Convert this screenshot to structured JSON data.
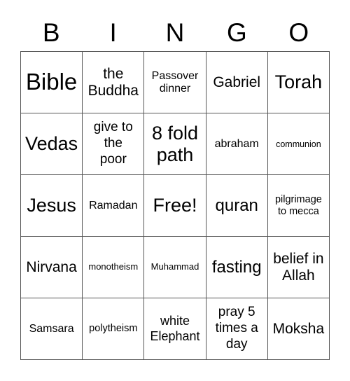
{
  "header": {
    "letters": [
      "B",
      "I",
      "N",
      "G",
      "O"
    ]
  },
  "card": {
    "rows": [
      [
        "Bible",
        "the Buddha",
        "Passover dinner",
        "Gabriel",
        "Torah"
      ],
      [
        "Vedas",
        "give to the poor",
        "8 fold path",
        "abraham",
        "communion"
      ],
      [
        "Jesus",
        "Ramadan",
        "Free!",
        "quran",
        "pilgrimage to mecca"
      ],
      [
        "Nirvana",
        "monotheism",
        "Muhammad",
        "fasting",
        "belief in Allah"
      ],
      [
        "Samsara",
        "polytheism",
        "white Elephant",
        "pray 5 times a day",
        "Moksha"
      ]
    ]
  }
}
